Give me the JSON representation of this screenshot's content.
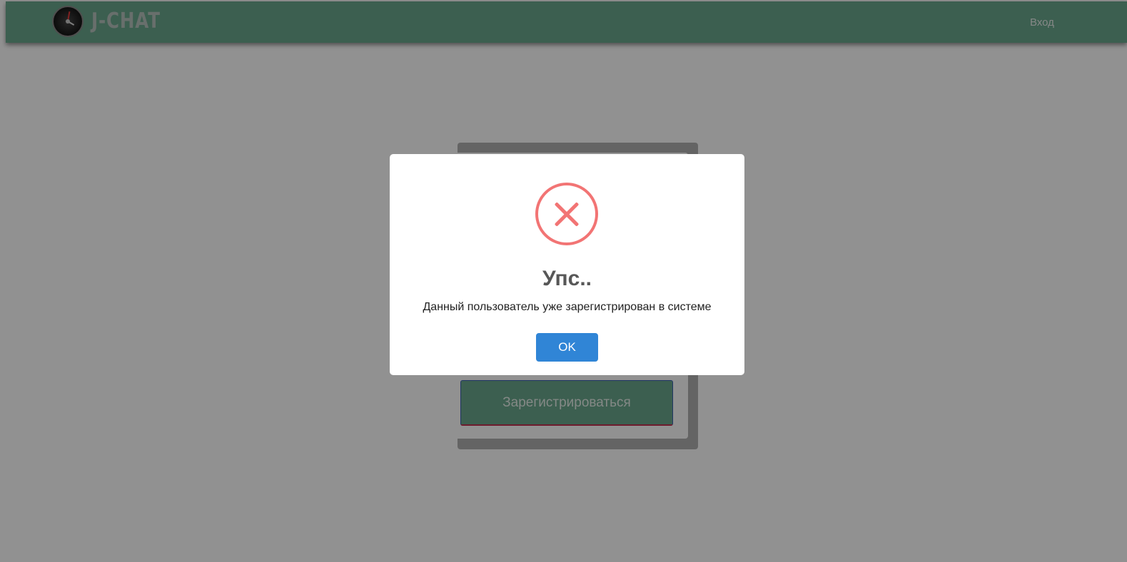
{
  "header": {
    "brand": "J-CHAT",
    "login_link": "Вход"
  },
  "form": {
    "register_button": "Зарегистрироваться"
  },
  "modal": {
    "icon": "error-x-icon",
    "title": "Упс..",
    "message": "Данный пользователь уже зарегистрирован в системе",
    "ok_label": "OK"
  },
  "colors": {
    "navbar": "#6aa88e",
    "error": "#f27474",
    "ok_button": "#3085d6",
    "overlay": "rgba(0,0,0,0.43)"
  }
}
